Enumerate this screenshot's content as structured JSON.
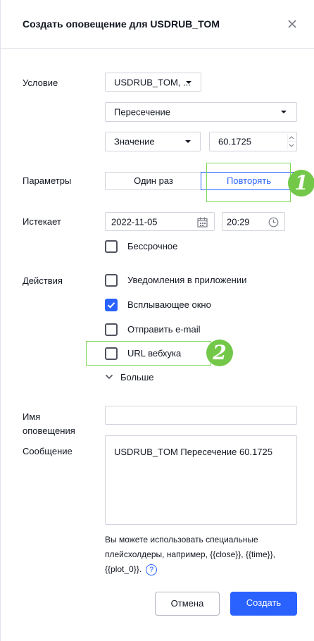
{
  "dialog": {
    "title": "Создать оповещение для USDRUB_TOM"
  },
  "condition": {
    "label": "Условие",
    "symbol": "USDRUB_TOM, ...",
    "operator": "Пересечение",
    "value_type": "Значение",
    "value": "60.1725"
  },
  "params": {
    "label": "Параметры",
    "once": "Один раз",
    "repeat": "Повторять",
    "selected": "Повторять"
  },
  "expires": {
    "label": "Истекает",
    "date": "2022-11-05",
    "time": "20:29",
    "unlimited_label": "Бессрочное"
  },
  "actions": {
    "label": "Действия",
    "items": [
      {
        "label": "Уведомления в приложении",
        "checked": false
      },
      {
        "label": "Всплывающее окно",
        "checked": true
      },
      {
        "label": "Отправить e-mail",
        "checked": false
      },
      {
        "label": "URL вебхука",
        "checked": false
      }
    ],
    "more": "Больше"
  },
  "alert_name": {
    "label": "Имя оповещения",
    "value": ""
  },
  "message": {
    "label": "Сообщение",
    "value": "USDRUB_TOM Пересечение 60.1725",
    "hint": "Вы можете использовать специальные плейсхолдеры, например, {{close}}, {{time}}, {{plot_0}}."
  },
  "buttons": {
    "cancel": "Отмена",
    "create": "Создать"
  },
  "annotations": {
    "badge1": "1",
    "badge2": "2"
  },
  "colors": {
    "accent": "#2962ff",
    "highlight": "#7ed957",
    "badge": "#73c849"
  }
}
